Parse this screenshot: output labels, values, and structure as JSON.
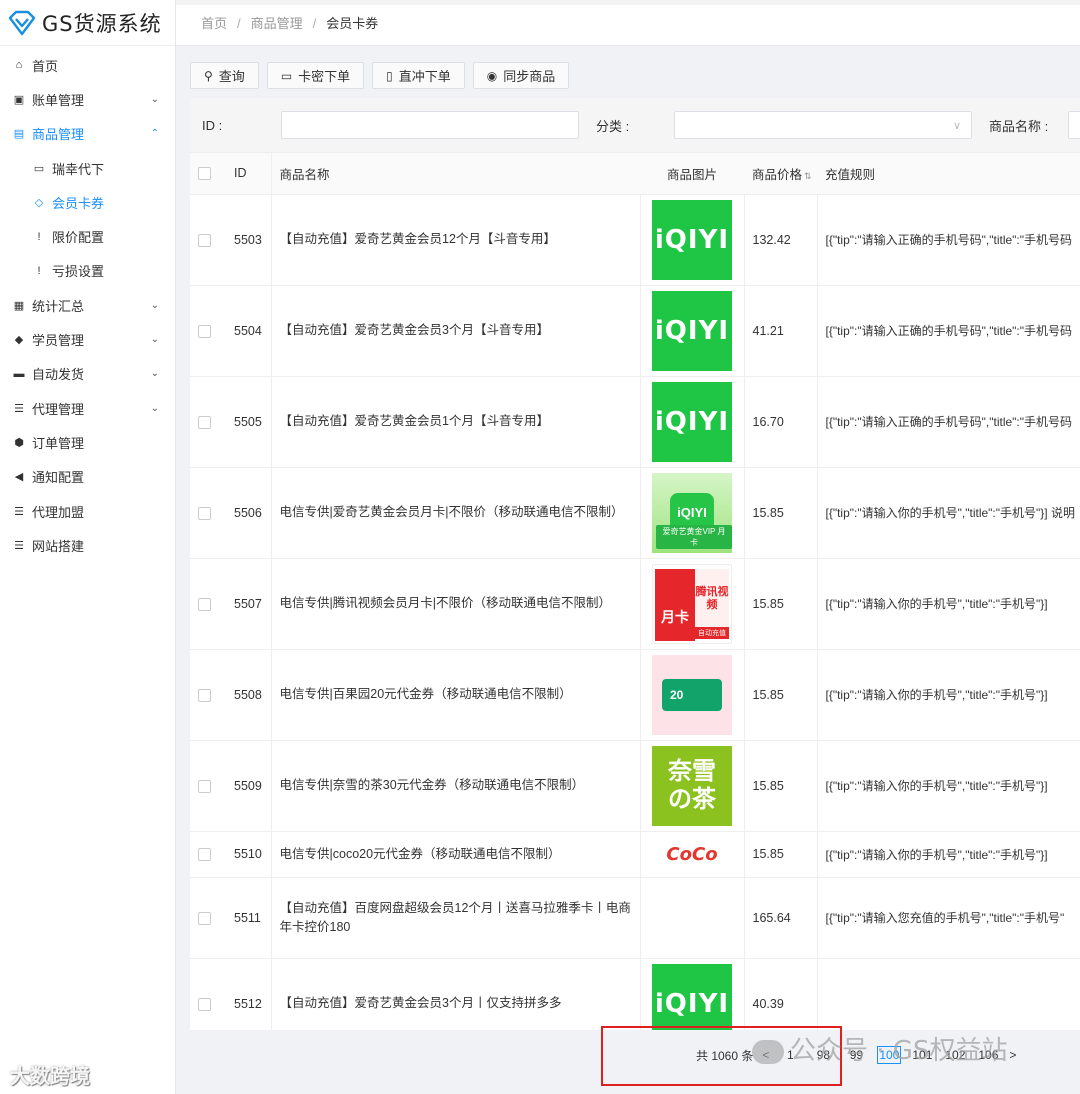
{
  "app": {
    "title": "GS货源系统"
  },
  "sidebar": {
    "items": [
      {
        "label": "首页",
        "icon": "home-icon",
        "glyph": "⌂"
      },
      {
        "label": "账单管理",
        "icon": "bill-icon",
        "glyph": "▣",
        "chevron": "⌄"
      },
      {
        "label": "商品管理",
        "icon": "goods-icon",
        "glyph": "▤",
        "chevron": "⌃"
      },
      {
        "label": "瑞幸代下",
        "icon": "calendar-icon",
        "glyph": "▭"
      },
      {
        "label": "会员卡券",
        "icon": "diamond-icon",
        "glyph": "◇"
      },
      {
        "label": "限价配置",
        "icon": "exclamation-icon",
        "glyph": "!"
      },
      {
        "label": "亏损设置",
        "icon": "exclamation-icon",
        "glyph": "!"
      },
      {
        "label": "统计汇总",
        "icon": "grid-icon",
        "glyph": "▦",
        "chevron": "⌄"
      },
      {
        "label": "学员管理",
        "icon": "tag-icon",
        "glyph": "◆",
        "chevron": "⌄"
      },
      {
        "label": "自动发货",
        "icon": "car-icon",
        "glyph": "▬",
        "chevron": "⌄"
      },
      {
        "label": "代理管理",
        "icon": "list-icon",
        "glyph": "☰",
        "chevron": "⌄"
      },
      {
        "label": "订单管理",
        "icon": "cube-icon",
        "glyph": "⬢"
      },
      {
        "label": "通知配置",
        "icon": "bullhorn-icon",
        "glyph": "◀"
      },
      {
        "label": "代理加盟",
        "icon": "list-icon",
        "glyph": "☰"
      },
      {
        "label": "网站搭建",
        "icon": "list-icon",
        "glyph": "☰"
      }
    ]
  },
  "breadcrumb": {
    "items": [
      "首页",
      "商品管理",
      "会员卡券"
    ],
    "sep": "/"
  },
  "toolbar": {
    "query": "查询",
    "query_glyph": "⚲",
    "card_order": "卡密下单",
    "card_glyph": "▭",
    "direct_order": "直冲下单",
    "direct_glyph": "▯",
    "sync": "同步商品",
    "sync_glyph": "◉"
  },
  "search": {
    "id_label": "ID :",
    "category_label": "分类 :",
    "name_label": "商品名称 :",
    "select_arrow": "∨"
  },
  "table": {
    "headers": {
      "id": "ID",
      "name": "商品名称",
      "image": "商品图片",
      "price": "商品价格",
      "sort": "⇅",
      "rule": "充值规则"
    },
    "rows": [
      {
        "id": "5503",
        "name": "【自动充值】爱奇艺黄金会员12个月【斗音专用】",
        "img": "iqiyi",
        "img_text": "iQIYI",
        "price": "132.42",
        "rule": "[{\"tip\":\"请输入正确的手机号码\",\"title\":\"手机号码"
      },
      {
        "id": "5504",
        "name": "【自动充值】爱奇艺黄金会员3个月【斗音专用】",
        "img": "iqiyi",
        "img_text": "iQIYI",
        "price": "41.21",
        "rule": "[{\"tip\":\"请输入正确的手机号码\",\"title\":\"手机号码"
      },
      {
        "id": "5505",
        "name": "【自动充值】爱奇艺黄金会员1个月【斗音专用】",
        "img": "iqiyi",
        "img_text": "iQIYI",
        "price": "16.70",
        "rule": "[{\"tip\":\"请输入正确的手机号码\",\"title\":\"手机号码"
      },
      {
        "id": "5506",
        "name": "电信专供|爱奇艺黄金会员月卡|不限价（移动联通电信不限制）",
        "img": "iqcard",
        "img_text": "iQIYI",
        "img_sub": "爱奇艺黄金VIP 月卡",
        "price": "15.85",
        "rule": "[{\"tip\":\"请输入你的手机号\",\"title\":\"手机号\"}] 说明"
      },
      {
        "id": "5507",
        "name": "电信专供|腾讯视频会员月卡|不限价（移动联通电信不限制）",
        "img": "tencent",
        "img_text": "月卡",
        "img_sub": "腾讯视频",
        "img_band": "自动充值",
        "price": "15.85",
        "rule": "[{\"tip\":\"请输入你的手机号\",\"title\":\"手机号\"}]"
      },
      {
        "id": "5508",
        "name": "电信专供|百果园20元代金券（移动联通电信不限制）",
        "img": "baiguoyuan",
        "img_text": "20",
        "price": "15.85",
        "rule": "[{\"tip\":\"请输入你的手机号\",\"title\":\"手机号\"}]"
      },
      {
        "id": "5509",
        "name": "电信专供|奈雪的茶30元代金券（移动联通电信不限制）",
        "img": "naixue",
        "img_text": "奈雪",
        "img_sub": "の茶",
        "price": "15.85",
        "rule": "[{\"tip\":\"请输入你的手机号\",\"title\":\"手机号\"}]"
      },
      {
        "id": "5510",
        "name": "电信专供|coco20元代金券（移动联通电信不限制）",
        "img": "coco",
        "img_text": "CoCo",
        "price": "15.85",
        "rule": "[{\"tip\":\"请输入你的手机号\",\"title\":\"手机号\"}]"
      },
      {
        "id": "5511",
        "name": "【自动充值】百度网盘超级会员12个月丨送喜马拉雅季卡丨电商年卡控价180",
        "img": "none",
        "img_text": "",
        "price": "165.64",
        "rule": "[{\"tip\":\"请输入您充值的手机号\",\"title\":\"手机号\""
      },
      {
        "id": "5512",
        "name": "【自动充值】爱奇艺黄金会员3个月丨仅支持拼多多",
        "img": "iqiyi",
        "img_text": "iQIYI",
        "price": "40.39",
        "rule": ""
      }
    ]
  },
  "pagination": {
    "total": "共 1060 条",
    "prev": "<",
    "pages": [
      "1",
      "98",
      "99",
      "100",
      "101",
      "102",
      "106"
    ],
    "current": "100",
    "next": ">"
  },
  "watermarks": {
    "wechat": "公众号 · GS权益站",
    "corner": "大数跨境"
  }
}
